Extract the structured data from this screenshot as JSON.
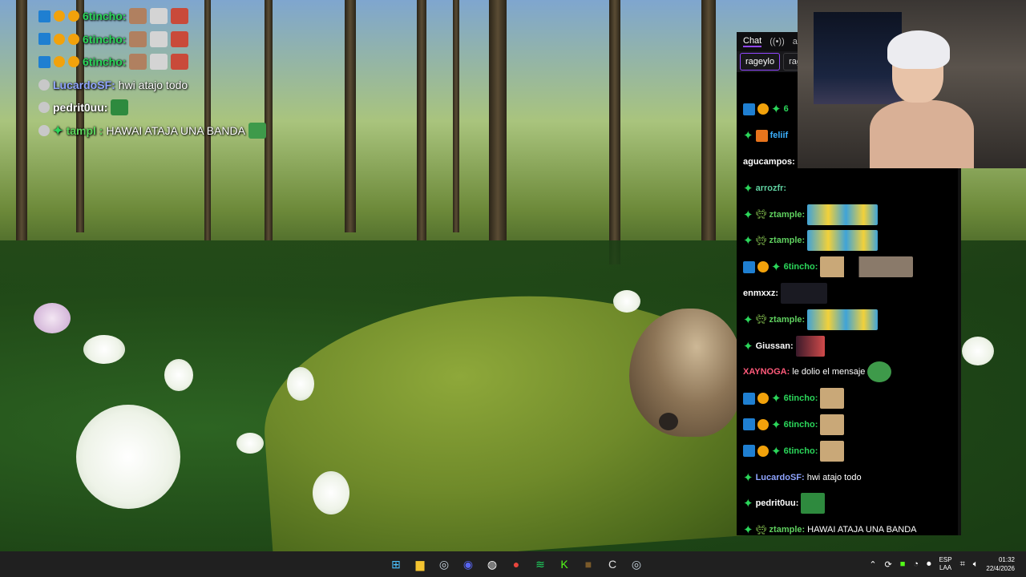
{
  "overlay": {
    "lines": [
      {
        "user": "6tincho:",
        "user_color": "#2bd65a",
        "msg": "",
        "badges": [
          "mod",
          "coin",
          "coin"
        ],
        "emote_colors": [
          "#b08060",
          "#d4d4d4",
          "#c94a3a"
        ]
      },
      {
        "user": "6tincho:",
        "user_color": "#2bd65a",
        "msg": "",
        "badges": [
          "mod",
          "coin",
          "coin"
        ],
        "emote_colors": [
          "#b08060",
          "#d4d4d4",
          "#c94a3a"
        ]
      },
      {
        "user": "6tincho:",
        "user_color": "#2bd65a",
        "msg": "",
        "badges": [
          "mod",
          "coin",
          "coin"
        ],
        "emote_colors": [
          "#b08060",
          "#d4d4d4",
          "#c94a3a"
        ]
      },
      {
        "user": "LucardoSF:",
        "user_color": "#8fa4ff",
        "msg": "hwi atajo todo",
        "badges": [
          "grey"
        ],
        "emote_colors": []
      },
      {
        "user": "pedrit0uu:",
        "user_color": "#ffffff",
        "msg": "",
        "badges": [
          "grey"
        ],
        "emote_colors": [
          "#2e8a3e"
        ]
      },
      {
        "user": "tampl :",
        "user_color": "#5cd65c",
        "msg": "HAWAI ATAJA UNA BANDA",
        "badges": [
          "grey",
          "green"
        ],
        "emote_colors": [
          "#3e9a4a"
        ]
      }
    ]
  },
  "chat": {
    "tabs": [
      "Chat",
      "ar"
    ],
    "channels": [
      "rageylo",
      "rag"
    ],
    "messages": [
      {
        "user": "6",
        "user_color": "#2bd65a",
        "text": "",
        "badges": [
          "mod",
          "coin",
          "green"
        ]
      },
      {
        "user": "feliif",
        "user_color": "#3bb0ff",
        "text": "",
        "badges": [
          "green",
          "gift"
        ]
      },
      {
        "user": "agucampos:",
        "user_color": "#ffffff",
        "text": "",
        "badges": []
      },
      {
        "user": "arrozfr:",
        "user_color": "#5fd0a0",
        "text": "",
        "badges": [
          "green"
        ]
      },
      {
        "user": "ztample:",
        "user_color": "#5fd05f",
        "text": "",
        "badges": [
          "green",
          "alien"
        ],
        "img": "minions"
      },
      {
        "user": "ztample:",
        "user_color": "#5fd05f",
        "text": "",
        "badges": [
          "green",
          "alien"
        ],
        "img": "minions"
      },
      {
        "user": "6tincho:",
        "user_color": "#2bd65a",
        "text": "",
        "badges": [
          "mod",
          "coin",
          "green"
        ],
        "img": "cats"
      },
      {
        "user": "enmxxz:",
        "user_color": "#ffffff",
        "text": "",
        "badges": [],
        "img": "dark"
      },
      {
        "user": "ztample:",
        "user_color": "#5fd05f",
        "text": "",
        "badges": [
          "green",
          "alien"
        ],
        "img": "minions"
      },
      {
        "user": "Giussan:",
        "user_color": "#ffffff",
        "text": "",
        "badges": [
          "green"
        ],
        "img": "red"
      },
      {
        "user": "XAYNOGA:",
        "user_color": "#ff5a7a",
        "text": "le dolio el mensaje",
        "badges": [],
        "img": "pepe"
      },
      {
        "user": "6tincho:",
        "user_color": "#2bd65a",
        "text": "",
        "badges": [
          "mod",
          "coin",
          "green"
        ],
        "img": "cat"
      },
      {
        "user": "6tincho:",
        "user_color": "#2bd65a",
        "text": "",
        "badges": [
          "mod",
          "coin",
          "green"
        ],
        "img": "cat"
      },
      {
        "user": "6tincho:",
        "user_color": "#2bd65a",
        "text": "",
        "badges": [
          "mod",
          "coin",
          "green"
        ],
        "img": "cat"
      },
      {
        "user": "LucardoSF:",
        "user_color": "#8fa4ff",
        "text": "hwi atajo todo",
        "badges": [
          "green"
        ]
      },
      {
        "user": "pedrit0uu:",
        "user_color": "#ffffff",
        "text": "",
        "badges": [
          "green"
        ],
        "img": "pepegreen"
      },
      {
        "user": "ztample:",
        "user_color": "#5fd05f",
        "text": "HAWAI ATAJA UNA BANDA",
        "badges": [
          "green",
          "alien"
        ]
      }
    ]
  },
  "taskbar": {
    "apps": [
      {
        "name": "windows-start",
        "glyph": "⊞",
        "color": "#4cc2ff"
      },
      {
        "name": "file-explorer",
        "glyph": "▆",
        "color": "#f4c430"
      },
      {
        "name": "steam",
        "glyph": "◎",
        "color": "#c7d5e0"
      },
      {
        "name": "discord",
        "glyph": "◉",
        "color": "#5865f2"
      },
      {
        "name": "obs",
        "glyph": "◍",
        "color": "#ffffff"
      },
      {
        "name": "chrome",
        "glyph": "●",
        "color": "#e8453c"
      },
      {
        "name": "spotify",
        "glyph": "≋",
        "color": "#1ed760"
      },
      {
        "name": "kick",
        "glyph": "K",
        "color": "#53fc18"
      },
      {
        "name": "minecraft",
        "glyph": "■",
        "color": "#7a5a2a"
      },
      {
        "name": "ccleaner",
        "glyph": "C",
        "color": "#e0e0e0"
      },
      {
        "name": "steam-2",
        "glyph": "◎",
        "color": "#c7d5e0"
      }
    ],
    "lang_top": "ESP",
    "lang_bottom": "LAA",
    "time": "01:32",
    "date": "22/4/2026"
  }
}
